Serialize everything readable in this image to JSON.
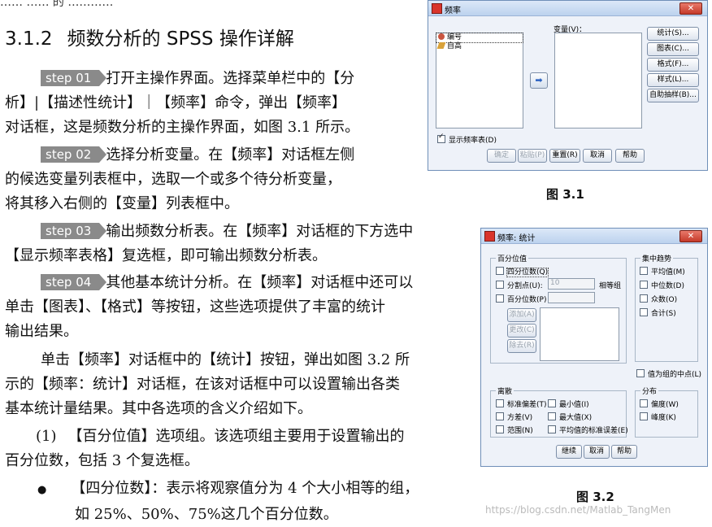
{
  "doc": {
    "top_fragment": "…… ……  的 …………",
    "section_number": "3.1.2",
    "section_title": "频数分析的 SPSS 操作详解",
    "step1": {
      "badge": "step 01",
      "l1": "打开主操作界面。选择菜单栏中的【分",
      "l2": "析】|【描述性统计】｜【频率】命令，弹出【频率】",
      "l3": "对话框，这是频数分析的主操作界面，如图 3.1 所示。"
    },
    "step2": {
      "badge": "step 02",
      "l1": "选择分析变量。在【频率】对话框左侧",
      "l2": "的候选变量列表框中，选取一个或多个待分析变量，",
      "l3": "将其移入右侧的【变量】列表框中。"
    },
    "step3": {
      "badge": "step 03",
      "l1": "输出频数分析表。在【频率】对话框的下方选中",
      "l2": "【显示频率表格】复选框，即可输出频数分析表。"
    },
    "step4": {
      "badge": "step 04",
      "l1": "其他基本统计分析。在【频率】对话框中还可以",
      "l2": "单击【图表】、【格式】等按钮，这些选项提供了丰富的统计",
      "l3": "输出结果。"
    },
    "p5": {
      "l1": "单击【频率】对话框中的【统计】按钮，弹出如图 3.2 所",
      "l2": "示的【频率：统计】对话框，在该对话框中可以设置输出各类",
      "l3": "基本统计量结果。其中各选项的含义介绍如下。"
    },
    "p6": {
      "num": "(1)",
      "l1": "【百分位值】选项组。该选项组主要用于设置输出的",
      "l2": "百分位数，包括 3 个复选框。"
    },
    "bullet": {
      "mark": "●",
      "l1": "【四分位数】：表示将观察值分为 4 个大小相等的组，",
      "l2": "如 25%、50%、75%这几个百分位数。"
    },
    "fig1_caption": "图 3.1",
    "fig2_caption": "图 3.2",
    "watermark": "https://blog.csdn.net/Matlab_TangMen"
  },
  "dlg1": {
    "title": "频率",
    "close_glyph": "✕",
    "var_items": [
      {
        "label": "编号",
        "icon": "nominal-icon"
      },
      {
        "label": "自高",
        "icon": "scale-icon"
      }
    ],
    "variables_label": "变量(V)：",
    "move_glyph": "➡",
    "side_buttons": [
      "统计(S)...",
      "图表(C)...",
      "格式(F)...",
      "样式(L)...",
      "自助抽样(B)..."
    ],
    "show_table_label": "显示频率表(D)",
    "bottom_buttons": [
      "确定",
      "粘贴(P)",
      "重置(R)",
      "取消",
      "帮助"
    ]
  },
  "dlg2": {
    "title": "频率: 统计",
    "close_glyph": "✕",
    "percentile_group": "百分位值",
    "quartiles": "四分位数(Q)",
    "cut_points": "分割点(U):",
    "cut_value": "10",
    "equal_groups": "相等组",
    "percentiles": "百分位数(P)",
    "add": "添加(A)",
    "change": "更改(C)",
    "remove": "除去(R)",
    "central_group": "集中趋势",
    "central_items": [
      "平均值(M)",
      "中位数(D)",
      "众数(O)",
      "合计(S)"
    ],
    "midpoints": "值为组的中点(L)",
    "dispersion_group": "离散",
    "dispersion_left": [
      "标准偏差(T)",
      "方差(V)",
      "范围(N)"
    ],
    "dispersion_right": [
      "最小值(I)",
      "最大值(X)",
      "平均值的标准误差(E)"
    ],
    "distribution_group": "分布",
    "distribution_items": [
      "偏度(W)",
      "峰度(K)"
    ],
    "bottom_buttons": [
      "继续",
      "取消",
      "帮助"
    ]
  }
}
